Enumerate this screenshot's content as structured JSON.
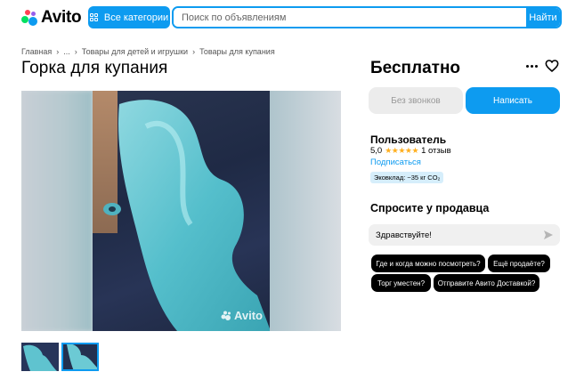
{
  "header": {
    "logo_text": "Avito",
    "categories_label": "Все категории",
    "search_placeholder": "Поиск по объявлениям",
    "search_button": "Найти",
    "accent_color": "#0d9bf0"
  },
  "breadcrumb": [
    "Главная",
    "...",
    "Товары для детей и игрушки",
    "Товары для купания"
  ],
  "listing": {
    "title": "Горка для купания",
    "price": "Бесплатно",
    "watermark": "Avito",
    "thumbnails_count": 2
  },
  "actions": {
    "no_calls_label": "Без звонков",
    "write_label": "Написать"
  },
  "seller": {
    "name": "Пользователь",
    "rating": "5,0",
    "stars": "★★★★★",
    "reviews": "1 отзыв",
    "subscribe_label": "Подписаться",
    "eco_badge": "Эковклад: ~35 кг CO₂"
  },
  "ask": {
    "title": "Спросите у продавца",
    "message": "Здравствуйте!",
    "chips": [
      "Где и когда можно посмотреть?",
      "Ещё продаёте?",
      "Торг уместен?",
      "Отправите Авито Доставкой?"
    ]
  }
}
